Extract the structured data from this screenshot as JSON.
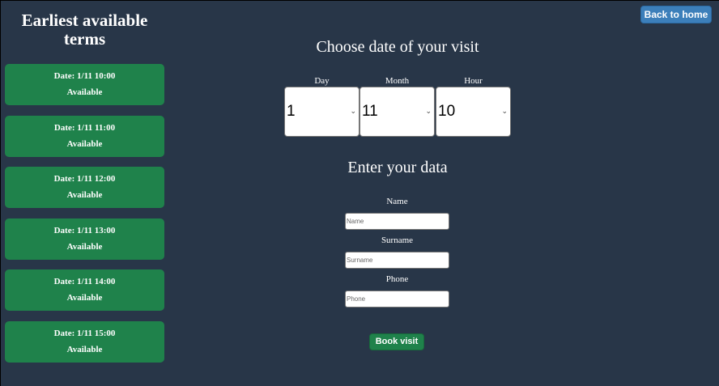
{
  "sidebar": {
    "title": "Earliest available terms",
    "slots": [
      {
        "date": "Date: 1/11 10:00",
        "status": "Available"
      },
      {
        "date": "Date: 1/11 11:00",
        "status": "Available"
      },
      {
        "date": "Date: 1/11 12:00",
        "status": "Available"
      },
      {
        "date": "Date: 1/11 13:00",
        "status": "Available"
      },
      {
        "date": "Date: 1/11 14:00",
        "status": "Available"
      },
      {
        "date": "Date: 1/11 15:00",
        "status": "Available"
      }
    ]
  },
  "header": {
    "back_label": "Back to home"
  },
  "date_picker": {
    "heading": "Choose date of your visit",
    "day": {
      "label": "Day",
      "value": "1"
    },
    "month": {
      "label": "Month",
      "value": "11"
    },
    "hour": {
      "label": "Hour",
      "value": "10"
    }
  },
  "form": {
    "heading": "Enter your data",
    "name": {
      "label": "Name",
      "placeholder": "Name"
    },
    "surname": {
      "label": "Surname",
      "placeholder": "Surname"
    },
    "phone": {
      "label": "Phone",
      "placeholder": "Phone"
    },
    "submit_label": "Book visit"
  },
  "colors": {
    "background": "#283648",
    "slot_green": "#1f824b",
    "back_button_blue": "#3c7fba"
  },
  "icons": {
    "select_chevron": "chevron-down-icon"
  }
}
